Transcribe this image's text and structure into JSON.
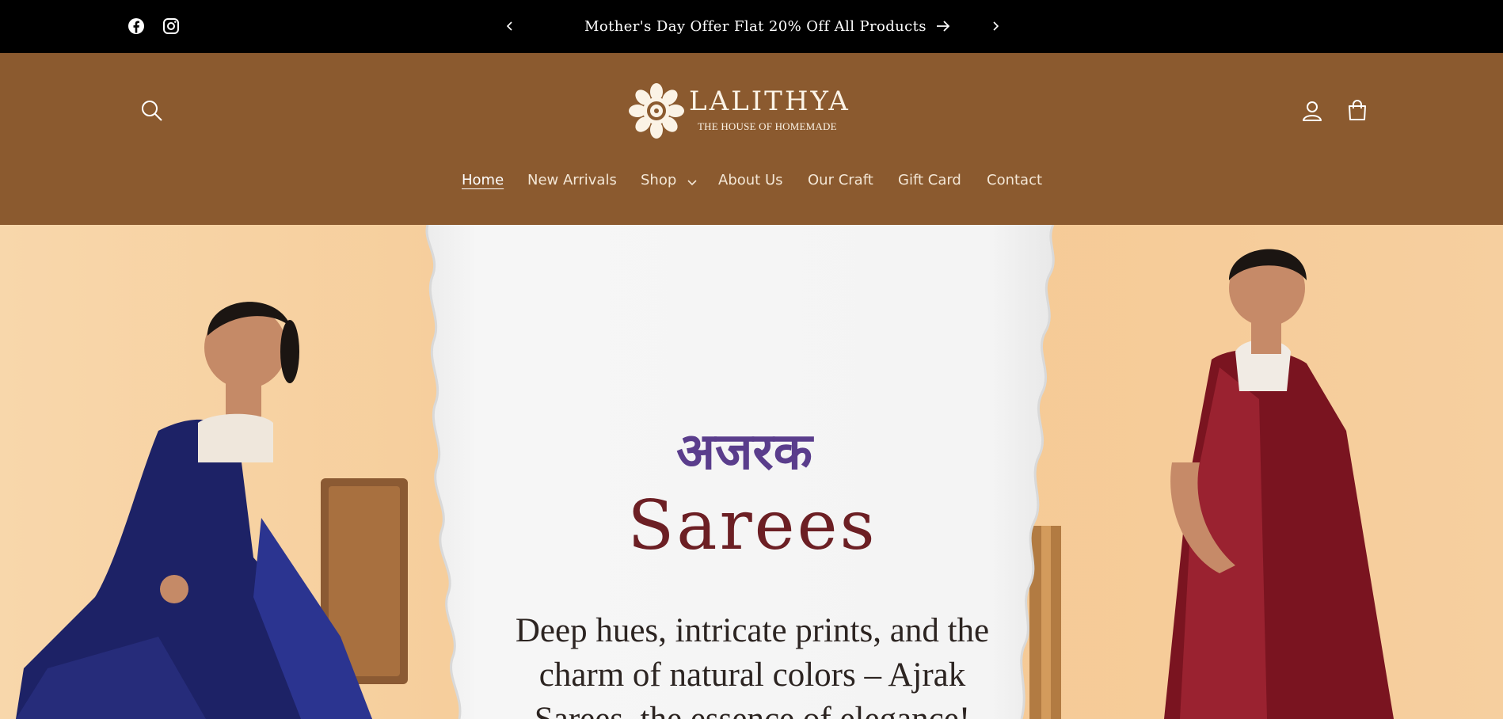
{
  "announcement": {
    "message": "Mother's Day Offer Flat 20% Off All Products",
    "social": [
      "facebook-icon",
      "instagram-icon"
    ],
    "prev_icon": "chevron-left-icon",
    "next_icon": "chevron-right-icon"
  },
  "header": {
    "logo": {
      "name": "LALITHYA",
      "tagline": "THE HOUSE OF HOMEMADE"
    },
    "icons": [
      "search-icon",
      "account-icon",
      "cart-icon"
    ],
    "nav": [
      {
        "label": "Home",
        "active": true
      },
      {
        "label": "New Arrivals"
      },
      {
        "label": "Shop",
        "has_dropdown": true
      },
      {
        "label": "About Us"
      },
      {
        "label": "Our Craft"
      },
      {
        "label": "Gift Card"
      },
      {
        "label": "Contact"
      }
    ]
  },
  "hero": {
    "hindi_title": "अजरक",
    "title": "Sarees",
    "body": "Deep hues, intricate prints, and the charm of natural colors – Ajrak Sarees, the essence of elegance!"
  },
  "colors": {
    "announcement_bg": "#000000",
    "header_bg": "#8b5a2f",
    "hero_bg": "#f6cf9f",
    "hindi_title": "#5a3d8c",
    "title": "#6c1f24"
  }
}
